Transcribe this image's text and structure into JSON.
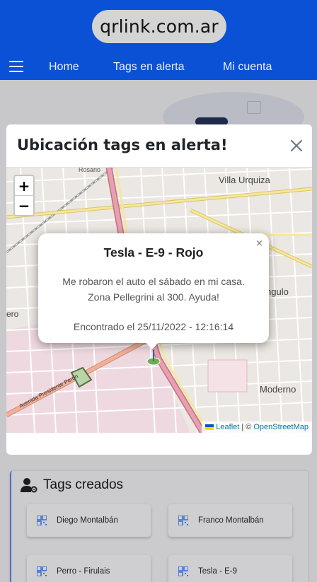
{
  "header": {
    "logo_text": "qrlink.com.ar",
    "nav": [
      "Home",
      "Tags en alerta",
      "Mi cuenta"
    ]
  },
  "modal": {
    "title": "Ubicación tags en alerta!",
    "map": {
      "zoom_in": "+",
      "zoom_out": "−",
      "labels": {
        "villa_urquiza": "Villa Urquiza",
        "rosario": "Rosario",
        "angulo": "ngulo",
        "ero": "ero",
        "moderno": "Moderno",
        "avenida": "Avenida Presidente Perón"
      },
      "popup": {
        "close": "×",
        "title": "Tesla - E-9 - Rojo",
        "desc_line1": "Me robaron el auto el sábado en mi casa.",
        "desc_line2": "Zona Pellegrini al 300. Ayuda!",
        "found": "Encontrado el 25/11/2022 - 12:16:14"
      },
      "attribution": {
        "leaflet": "Leaflet",
        "separator": "| ©",
        "osm": "OpenStreetMap"
      }
    }
  },
  "tags_section": {
    "title": "Tags creados",
    "tags": [
      "Diego Montalbán",
      "Franco Montalbán",
      "Perro - Firulais",
      "Tesla - E-9"
    ]
  },
  "colors": {
    "header_blue": "#0a51d6",
    "accent_blue": "#3a6fd8",
    "map_main_road": "#e8a0b0"
  }
}
